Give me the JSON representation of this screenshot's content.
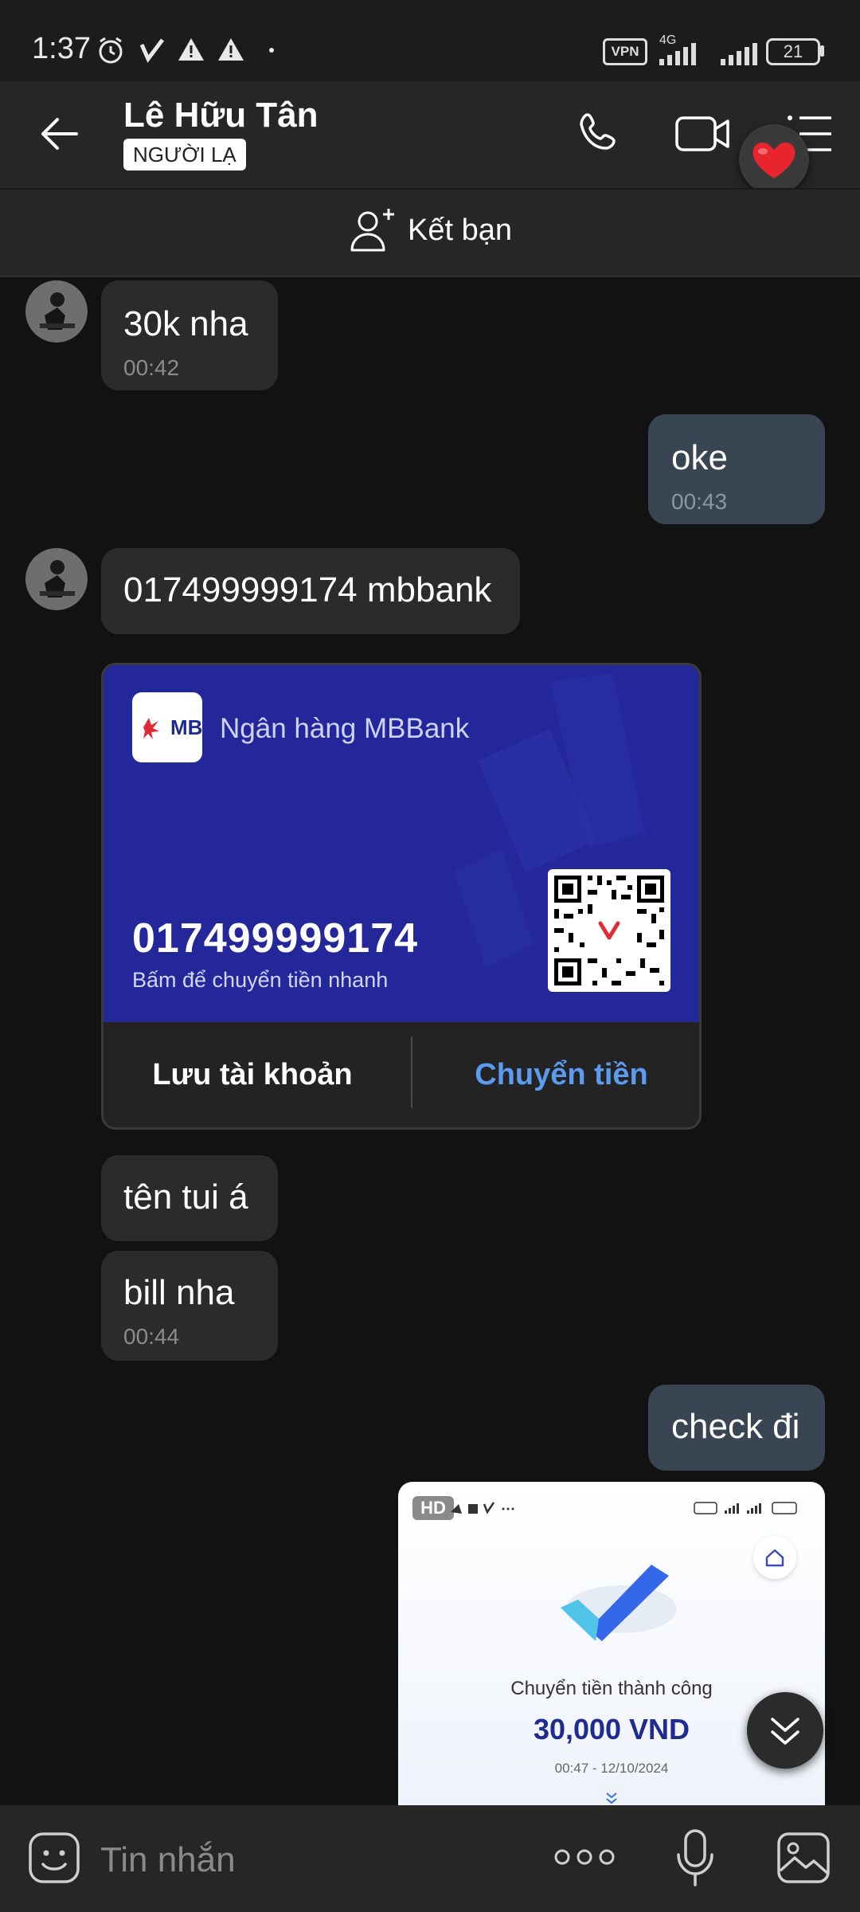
{
  "status_bar": {
    "time": "1:37",
    "vpn": "VPN",
    "network": "4G",
    "battery": "21"
  },
  "header": {
    "contact_name": "Lê Hữu Tân",
    "badge": "NGƯỜI LẠ",
    "icons": [
      "back-arrow-icon",
      "phone-icon",
      "video-call-icon",
      "menu-icon",
      "heart-icon"
    ]
  },
  "add_friend": {
    "label": "Kết bạn"
  },
  "messages": [
    {
      "side": "in",
      "text": "30k nha",
      "time": "00:42"
    },
    {
      "side": "out",
      "text": "oke",
      "time": "00:43"
    },
    {
      "side": "in",
      "text": "017499999174 mbbank"
    },
    {
      "side": "in",
      "text": "tên tui á"
    },
    {
      "side": "in",
      "text": "bill nha",
      "time": "00:44"
    },
    {
      "side": "out",
      "text": "check đi"
    }
  ],
  "bank_card": {
    "logo_text": "MB",
    "bank_name": "Ngân hàng MBBank",
    "account_number": "017499999174",
    "subtitle": "Bấm để chuyển tiền nhanh",
    "save_label": "Lưu tài khoản",
    "transfer_label": "Chuyển tiền",
    "accent": "#5b9bf0",
    "card_color": "#23279a"
  },
  "image_message": {
    "hd": "HD",
    "success_text": "Chuyển tiền thành công",
    "amount": "30,000 VND",
    "datetime": "00:47 - 12/10/2024"
  },
  "input_bar": {
    "placeholder": "Tin nhắn",
    "icons": [
      "sticker-icon",
      "more-icon",
      "microphone-icon",
      "gallery-icon"
    ]
  }
}
